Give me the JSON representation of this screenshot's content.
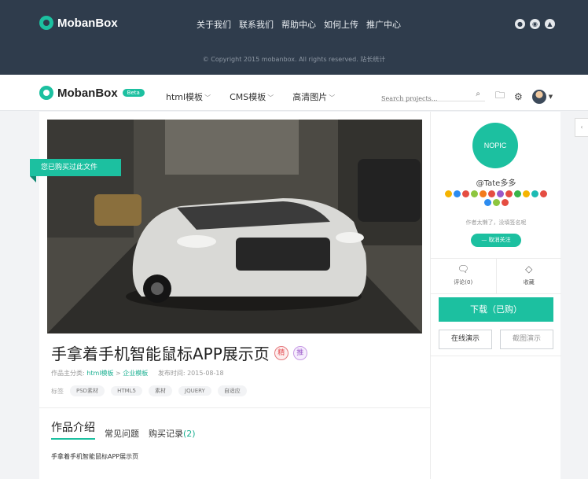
{
  "topbar": {
    "brand": "MobanBox",
    "nav": [
      "关于我们",
      "联系我们",
      "帮助中心",
      "如何上传",
      "推广中心"
    ],
    "social_icons": [
      "wechat-icon",
      "weibo-icon",
      "qq-icon"
    ],
    "copyright": "© Copyright 2015 mobanbox. All rights reserved.   站长统计"
  },
  "navbar": {
    "brand": "MobanBox",
    "badge": "Beta",
    "menu": [
      {
        "label": "html模板"
      },
      {
        "label": "CMS模板"
      },
      {
        "label": "高清图片"
      }
    ],
    "search_placeholder": "Search projects...",
    "icons": [
      "calendar-icon",
      "settings-icon",
      "avatar"
    ]
  },
  "product": {
    "ribbon": "您已购买过此文件",
    "title": "手拿着手机智能鼠标APP展示页",
    "badge_jing": "精",
    "badge_tui": "推",
    "meta": {
      "category_label": "作品主分类:",
      "category_main": "html模板",
      "category_sep": ">",
      "category_sub": "企业模板",
      "date_label": "发布时间:",
      "date": "2015-08-18"
    },
    "tags_label": "标签",
    "tags": [
      "PSD素材",
      "HTML5",
      "素材",
      "JQUERY",
      "自适应"
    ],
    "tabs": {
      "intro": "作品介绍",
      "faq": "常见问题",
      "purchases": "购买记录",
      "purchase_count": "(2)"
    },
    "description": "手拿着手机智能鼠标APP展示页"
  },
  "sidebar": {
    "avatar_text": "NOPIC",
    "username": "@Tate多多",
    "badge_colors": [
      "#f5b400",
      "#2d8cf0",
      "#e54d42",
      "#8dc63f",
      "#f37b1d",
      "#e54d42",
      "#9b59c9",
      "#e54d42",
      "#39b54a",
      "#f5b400",
      "#1cbbb4",
      "#e54d42",
      "#2d8cf0",
      "#8dc63f",
      "#e54d42"
    ],
    "bio": "作者太懒了，没填签名呢",
    "unfollow": "— 取消关注",
    "comments": "评论(0)",
    "favorite": "收藏",
    "download": "下载（已购）",
    "online_demo": "在线演示",
    "screenshot_demo": "截图演示"
  }
}
